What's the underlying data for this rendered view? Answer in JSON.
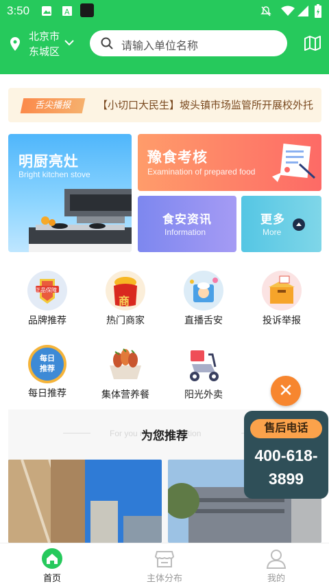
{
  "statusbar": {
    "time": "3:50"
  },
  "header": {
    "city": "北京市",
    "district": "东城区",
    "search_placeholder": "请输入单位名称"
  },
  "ticker": {
    "tag": "舌尖播报",
    "news": "【小切口大民生】坡头镇市场监管所开展校外托"
  },
  "cards": {
    "kitchen": {
      "title": "明厨亮灶",
      "subtitle": "Bright kitchen stove"
    },
    "exam": {
      "title": "豫食考核",
      "subtitle": "Examination of prepared food"
    },
    "info": {
      "title": "食安资讯",
      "subtitle": "Information"
    },
    "more": {
      "title": "更多",
      "subtitle": "More"
    }
  },
  "grid": [
    {
      "label": "品牌推荐",
      "icon": "brand-badge-icon",
      "badge": "正品保障"
    },
    {
      "label": "热门商家",
      "icon": "merchant-bag-icon",
      "badge": "商"
    },
    {
      "label": "直播舌安",
      "icon": "live-chef-icon"
    },
    {
      "label": "投诉举报",
      "icon": "complaint-box-icon"
    },
    {
      "label": "每日推荐",
      "icon": "daily-badge-icon",
      "badge": "每日推荐"
    },
    {
      "label": "集体营养餐",
      "icon": "meal-basket-icon"
    },
    {
      "label": "阳光外卖",
      "icon": "delivery-scooter-icon"
    }
  ],
  "recommend": {
    "title": "为您推荐",
    "subtitle": "For you recommendation"
  },
  "hotline": {
    "label": "售后电话",
    "number": "400-618-3899"
  },
  "tabs": [
    {
      "label": "首页",
      "icon": "home-icon",
      "active": true
    },
    {
      "label": "主体分布",
      "icon": "store-icon",
      "active": false
    },
    {
      "label": "我的",
      "icon": "profile-icon",
      "active": false
    }
  ],
  "colors": {
    "brand": "#26c95c",
    "accent": "#f7862f",
    "hotline": "#2f4f58"
  }
}
